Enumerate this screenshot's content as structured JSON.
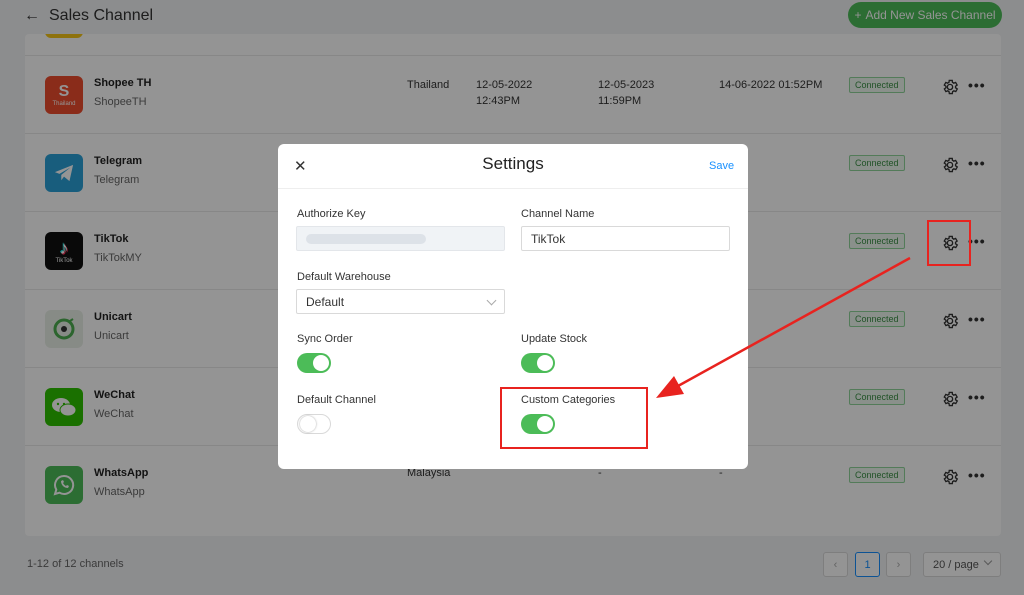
{
  "header": {
    "back_icon": "arrow-left-icon",
    "title": "Sales Channel",
    "add_button": "Add New Sales Channel"
  },
  "channels": [
    {
      "name": "Shopee TH",
      "handle": "ShopeeTH",
      "logo_text": "S",
      "logo_sub": "Thailand",
      "logo_color": "#ee4d2d",
      "country": "Thailand",
      "date1": "12-05-2022",
      "time1": "12:43PM",
      "date2": "12-05-2023",
      "time2": "11:59PM",
      "synced": "14-06-2022 01:52PM",
      "status": "Connected"
    },
    {
      "name": "Telegram",
      "handle": "Telegram",
      "logo_color": "#2aa0d8",
      "status": "Connected"
    },
    {
      "name": "TikTok",
      "handle": "TikTokMY",
      "logo_sub": "TikTok",
      "logo_color": "#111111",
      "status": "Connected"
    },
    {
      "name": "Unicart",
      "handle": "Unicart",
      "logo_color": "#e9efe7",
      "status": "Connected"
    },
    {
      "name": "WeChat",
      "handle": "WeChat",
      "logo_color": "#2dc100",
      "status": "Connected"
    },
    {
      "name": "WhatsApp",
      "handle": "WhatsApp",
      "logo_color": "#4cbc58",
      "country": "Malaysia",
      "date1": "-",
      "date2": "-",
      "status": "Connected"
    }
  ],
  "footer": {
    "count": "1-12 of 12 channels",
    "page": "1",
    "page_size": "20 / page"
  },
  "modal": {
    "title": "Settings",
    "save": "Save",
    "close_icon": "close-icon",
    "authorize_key_label": "Authorize Key",
    "channel_name_label": "Channel Name",
    "channel_name_value": "TikTok",
    "default_warehouse_label": "Default Warehouse",
    "default_warehouse_value": "Default",
    "sync_order_label": "Sync Order",
    "sync_order_on": true,
    "update_stock_label": "Update Stock",
    "update_stock_on": true,
    "default_channel_label": "Default Channel",
    "default_channel_on": false,
    "custom_categories_label": "Custom Categories",
    "custom_categories_on": true
  },
  "colors": {
    "accent_green": "#4cbc58",
    "link_blue": "#1890ff",
    "annotation_red": "#e8231f"
  }
}
